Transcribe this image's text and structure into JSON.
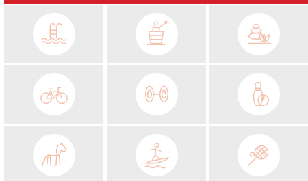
{
  "colors": {
    "topbar": "#d42028",
    "tile_background": "#ebebeb",
    "icon_circle": "#ffffff",
    "icon_stroke": "#f3c1ad"
  },
  "tiles": [
    {
      "icon": "swimming-pool-icon"
    },
    {
      "icon": "sauna-bucket-icon"
    },
    {
      "icon": "spa-stones-icon"
    },
    {
      "icon": "bicycle-icon"
    },
    {
      "icon": "weights-icon"
    },
    {
      "icon": "bowling-icon"
    },
    {
      "icon": "horse-riding-icon"
    },
    {
      "icon": "surfing-icon"
    },
    {
      "icon": "tennis-icon"
    }
  ]
}
